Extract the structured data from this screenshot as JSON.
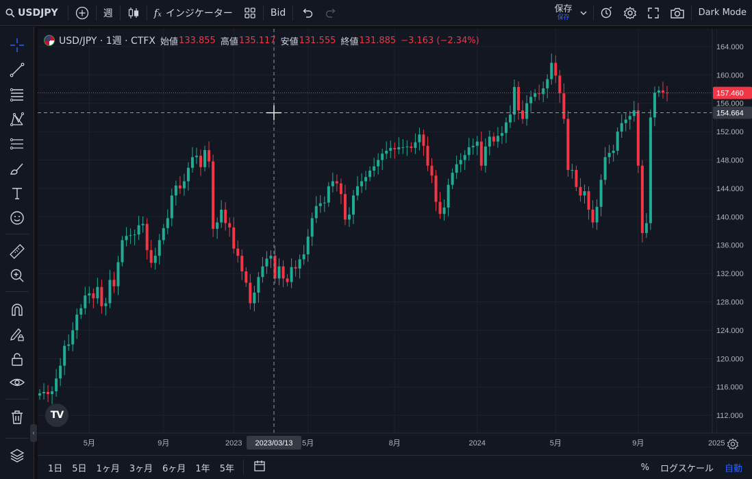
{
  "toolbar": {
    "symbol": "USDJPY",
    "interval": "週",
    "indicators_label": "インジケーター",
    "price_type": "Bid",
    "save_label": "保存",
    "save_sub": "保存",
    "dark_mode": "Dark Mode"
  },
  "legend": {
    "title": "USD/JPY · 1週 · CTFX",
    "open_label": "始値",
    "open": "133.855",
    "high_label": "高値",
    "high": "135.117",
    "low_label": "安値",
    "low": "131.555",
    "close_label": "終値",
    "close": "131.885",
    "change": "−3.163 (−2.34%)"
  },
  "colors": {
    "up": "#22ab94",
    "down": "#f23645",
    "background": "#131722",
    "grid": "#1f2330",
    "accent": "#2962ff"
  },
  "bottom": {
    "ranges": [
      "1日",
      "5日",
      "1ヶ月",
      "3ヶ月",
      "6ヶ月",
      "1年",
      "5年"
    ],
    "percent": "%",
    "log_scale": "ログスケール",
    "auto": "自動"
  },
  "left_tools": [
    "crosshair-icon",
    "trendline-icon",
    "fib-icon",
    "pattern-icon",
    "forecast-icon",
    "brush-icon",
    "text-icon",
    "emoji-icon",
    "ruler-icon",
    "zoom-in-icon",
    "magnet-icon",
    "lock-drawing-icon",
    "lock-icon",
    "eye-icon",
    "trash-icon",
    "layers-icon"
  ],
  "chart_data": {
    "type": "candlestick",
    "title": "USD/JPY · 1週 · CTFX",
    "ylim": [
      109.5,
      166.5
    ],
    "y_ticks": [
      "164.000",
      "160.000",
      "156.000",
      "152.000",
      "148.000",
      "144.000",
      "140.000",
      "136.000",
      "132.000",
      "128.000",
      "124.000",
      "120.000",
      "116.000",
      "112.000"
    ],
    "x_ticks": [
      "5月",
      "9月",
      "2023",
      "5月",
      "8月",
      "2024",
      "5月",
      "9月",
      "2025"
    ],
    "crosshair": {
      "date": "2023/03/13",
      "price": "154.664"
    },
    "last_price": "157.460",
    "grid": true,
    "close_series": [
      115.1,
      115.3,
      115.0,
      115.4,
      117.2,
      119.0,
      121.8,
      122.0,
      124.0,
      126.2,
      127.1,
      128.9,
      129.2,
      128.5,
      130.1,
      127.4,
      127.8,
      131.1,
      130.2,
      133.6,
      136.7,
      137.3,
      137.4,
      137.5,
      138.8,
      139.0,
      135.3,
      133.5,
      134.5,
      136.7,
      138.4,
      139.8,
      143.0,
      144.4,
      144.0,
      145.0,
      146.9,
      148.4,
      148.6,
      147.0,
      149.4,
      147.8,
      138.3,
      139.2,
      141.0,
      139.1,
      138.5,
      135.5,
      134.5,
      132.3,
      130.7,
      127.8,
      129.3,
      131.5,
      133.0,
      134.1,
      134.5,
      131.3,
      133.0,
      131.3,
      130.8,
      132.9,
      132.7,
      134.0,
      134.7,
      137.2,
      139.8,
      141.5,
      141.9,
      142.0,
      144.3,
      145.0,
      144.7,
      143.2,
      139.6,
      140.3,
      143.0,
      144.3,
      145.0,
      145.6,
      146.5,
      147.1,
      148.0,
      148.9,
      149.3,
      149.7,
      149.5,
      149.8,
      149.8,
      149.9,
      149.7,
      150.5,
      151.6,
      150.0,
      147.2,
      145.8,
      142.1,
      140.4,
      141.3,
      144.5,
      146.2,
      147.4,
      148.0,
      148.7,
      149.8,
      150.0,
      150.6,
      147.2,
      149.9,
      151.3,
      150.6,
      151.4,
      151.8,
      153.3,
      154.4,
      158.3,
      155.0,
      153.8,
      156.0,
      156.9,
      157.4,
      157.3,
      158.1,
      159.4,
      161.7,
      159.9,
      157.4,
      153.8,
      146.6,
      146.6,
      144.2,
      143.0,
      143.6,
      141.0,
      139.2,
      141.4,
      145.2,
      148.4,
      149.0,
      149.3,
      152.0,
      153.2,
      153.7,
      154.2,
      155.0,
      147.2,
      137.7,
      139.1,
      154.0,
      157.5,
      157.8,
      157.5,
      157.4
    ]
  }
}
